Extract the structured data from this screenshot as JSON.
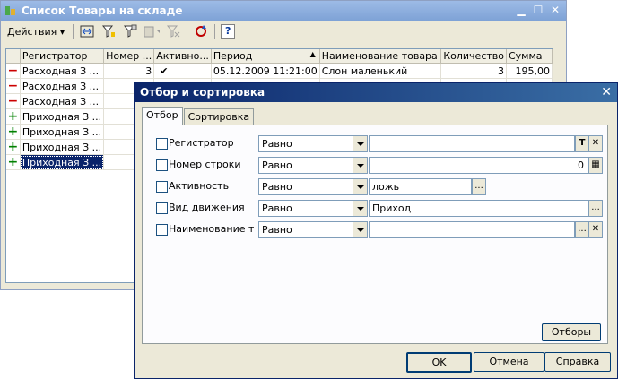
{
  "main_window": {
    "title": "Список Товары на складе",
    "toolbar": {
      "actions_label": "Действия ▾",
      "help_label": "?"
    },
    "columns": [
      "Регистратор",
      "Номер ...",
      "Активно...",
      "Период",
      "Наименование товара",
      "Количество",
      "Сумма"
    ],
    "sort_indicator": "▲",
    "rows": [
      {
        "mark": "−",
        "type": "minus",
        "registrar": "Расходная З ...",
        "line_no": "3",
        "active": "✔",
        "period": "05.12.2009 11:21:00",
        "product": "Слон маленький",
        "qty": "3",
        "sum": "195,00"
      },
      {
        "mark": "−",
        "type": "minus",
        "registrar": "Расходная З ...",
        "line_no": "",
        "active": "",
        "period": "",
        "product": "",
        "qty": "",
        "sum": ""
      },
      {
        "mark": "−",
        "type": "minus",
        "registrar": "Расходная З ...",
        "line_no": "",
        "active": "",
        "period": "",
        "product": "",
        "qty": "",
        "sum": ""
      },
      {
        "mark": "+",
        "type": "plus",
        "registrar": "Приходная З ...",
        "line_no": "",
        "active": "",
        "period": "",
        "product": "",
        "qty": "",
        "sum": ""
      },
      {
        "mark": "+",
        "type": "plus",
        "registrar": "Приходная З ...",
        "line_no": "",
        "active": "",
        "period": "",
        "product": "",
        "qty": "",
        "sum": ""
      },
      {
        "mark": "+",
        "type": "plus",
        "registrar": "Приходная З ...",
        "line_no": "",
        "active": "",
        "period": "",
        "product": "",
        "qty": "",
        "sum": ""
      },
      {
        "mark": "+",
        "type": "plus",
        "registrar": "Приходная З ...",
        "line_no": "",
        "active": "",
        "period": "",
        "product": "",
        "qty": "",
        "sum": ""
      }
    ]
  },
  "dialog": {
    "title": "Отбор и сортировка",
    "close_glyph": "✕",
    "tabs": [
      {
        "label": "Отбор"
      },
      {
        "label": "Сортировка"
      }
    ],
    "filters": [
      {
        "label": "Регистратор",
        "comparison": "Равно",
        "value": "",
        "btn1": "T",
        "btn2": "✕"
      },
      {
        "label": "Номер строки",
        "comparison": "Равно",
        "value": "0",
        "btn1": "▦"
      },
      {
        "label": "Активность",
        "comparison": "Равно",
        "value": "ложь",
        "btn1": "..."
      },
      {
        "label": "Вид движения",
        "comparison": "Равно",
        "value": "Приход",
        "btn1": "..."
      },
      {
        "label": "Наименование т...",
        "comparison": "Равно",
        "value": "",
        "btn1": "...",
        "btn2": "✕"
      }
    ],
    "filters_button": "Отборы",
    "ok_button": "OK",
    "cancel_button": "Отмена",
    "help_button": "Справка"
  }
}
